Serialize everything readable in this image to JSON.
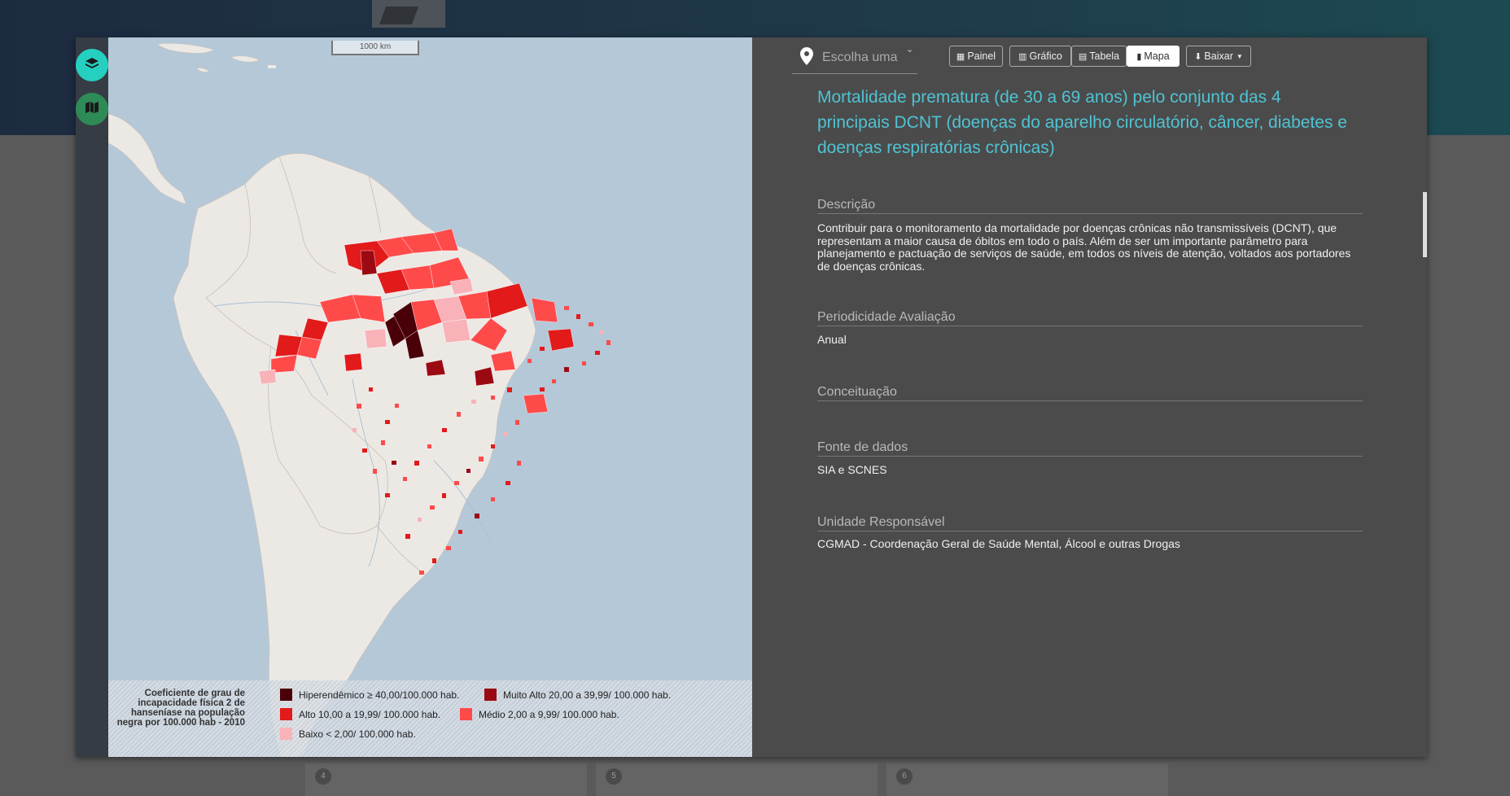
{
  "colors": {
    "accent": "#4fc3d3",
    "hiperendemico": "#4a0008",
    "muito_alto": "#9b0a12",
    "alto": "#e21a1a",
    "medio": "#ff4a4a",
    "baixo": "#f8b2b8"
  },
  "background": {
    "cards": [
      "4",
      "5",
      "6"
    ]
  },
  "map": {
    "scale_label": "1000 km",
    "sidebar": [
      {
        "icon": "layers-icon"
      },
      {
        "icon": "map-icon"
      }
    ],
    "legend": {
      "title": "Coeficiente de grau de incapacidade física 2 de hanseníase na população negra por 100.000 hab - 2010",
      "items": [
        {
          "label": "Hiperendêmico ≥ 40,00/100.000 hab.",
          "color": "#4a0008"
        },
        {
          "label": "Muito Alto 20,00 a 39,99/ 100.000 hab.",
          "color": "#9b0a12"
        },
        {
          "label": "Alto 10,00 a 19,99/ 100.000 hab.",
          "color": "#e21a1a"
        },
        {
          "label": "Médio 2,00 a 9,99/ 100.000 hab.",
          "color": "#ff4a4a"
        },
        {
          "label": "Baixo < 2,00/ 100.000 hab.",
          "color": "#f8b2b8"
        }
      ]
    }
  },
  "toolbar": {
    "location_placeholder": "Escolha uma",
    "buttons": {
      "painel": "Painel",
      "grafico": "Gráfico",
      "tabela": "Tabela",
      "mapa": "Mapa",
      "baixar": "Baixar"
    }
  },
  "indicator": {
    "title": "Mortalidade prematura (de 30 a 69 anos) pelo conjunto das 4 principais DCNT (doenças do aparelho circulatório, câncer, diabetes e doenças respiratórias crônicas)",
    "sections": [
      {
        "heading": "Descrição",
        "text": "Contribuir para o monitoramento da mortalidade por doenças crônicas não transmissíveis (DCNT), que representam a maior causa de óbitos em todo o país. Além de ser um importante parâmetro para planejamento e pactuação de serviços de saúde, em todos os níveis de atenção, voltados aos portadores de doenças crônicas."
      },
      {
        "heading": "Periodicidade Avaliação",
        "text": "Anual"
      },
      {
        "heading": "Conceituação",
        "text": ""
      },
      {
        "heading": "Fonte de dados",
        "text": "SIA e SCNES"
      },
      {
        "heading": "Unidade Responsável",
        "text": "CGMAD - Coordenação Geral de Saúde Mental, Álcool e outras Drogas"
      }
    ]
  }
}
